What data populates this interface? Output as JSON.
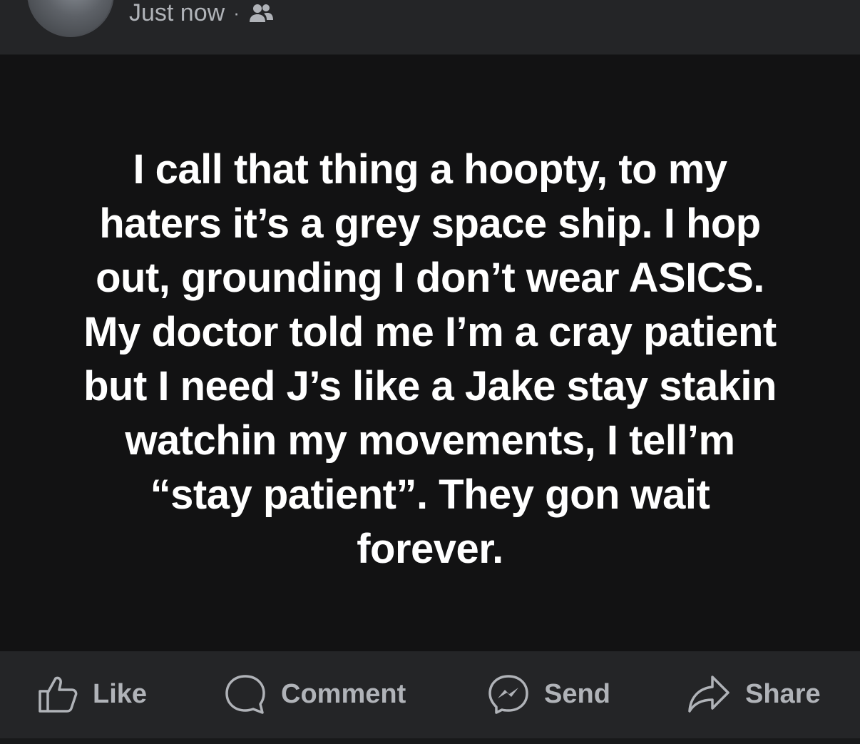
{
  "post": {
    "timestamp": "Just now",
    "separator": "·",
    "audience_icon": "friends-icon",
    "text": "I call that thing a hoopty, to my haters it’s a grey space ship.  I hop out, grounding I don’t wear ASICS. My doctor told me I’m a cray patient but I need J’s like a Jake stay stakin watchin my movements, I tell’m “stay patient”. They gon wait forever."
  },
  "actions": {
    "like": "Like",
    "comment": "Comment",
    "send": "Send",
    "share": "Share"
  },
  "colors": {
    "surface": "#242527",
    "post_background": "#121213",
    "text_primary": "#ffffff",
    "text_secondary": "#b0b3b8"
  }
}
